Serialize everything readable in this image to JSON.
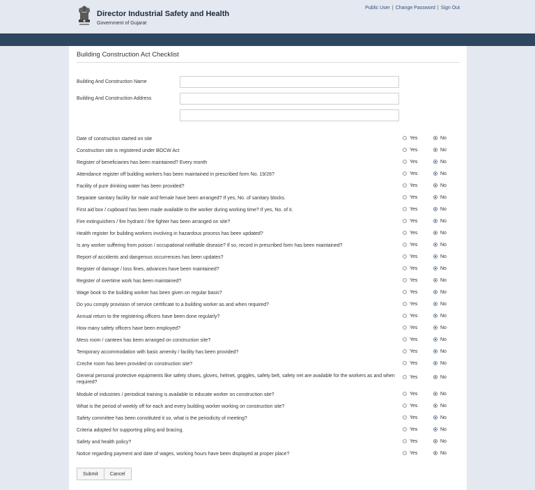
{
  "header": {
    "title": "Director Industrial Safety and Health",
    "subtitle": "Government of Gujarat",
    "links": {
      "public_user": "Public User",
      "sep1": "|",
      "change_password": "Change Password",
      "sep2": "|",
      "sign_out": "Sign Out"
    }
  },
  "form": {
    "heading": "Building Construction Act Checklist",
    "name_label": "Building And Construction Name",
    "address_label": "Building And Construction Address",
    "name_value": "",
    "address_value": "",
    "address_line2_value": "",
    "yes_label": "Yes",
    "no_label": "No",
    "questions": [
      {
        "text": "Date of construction started on site",
        "answer": "No"
      },
      {
        "text": "Construction site is registered under BOCW Act",
        "answer": "No"
      },
      {
        "text": "Register of beneficiaries has been maintained? Every month",
        "answer": "No"
      },
      {
        "text": "Attendance register off building workers has been maintained in prescribed form No. 19/26?",
        "answer": "No"
      },
      {
        "text": "Facility of pure drinking water has been provided?",
        "answer": "No"
      },
      {
        "text": "Separate sanitary facility for male and female have been arranged? If yes, No. of sanitary blocks.",
        "answer": "No"
      },
      {
        "text": "First aid box / cupboard has been made available to the worker during working time? If yes, No. of it.",
        "answer": "No"
      },
      {
        "text": "Fire extinguishers / fire hydrant / fire fighter has been arranged on site?",
        "answer": "No"
      },
      {
        "text": "Health register for building workers involving in hazardous process has been updated?",
        "answer": "No"
      },
      {
        "text": "Is any worker suffering from poison / occupational notifiable disease? If so, record in prescribed form has been maintained?",
        "answer": "No"
      },
      {
        "text": "Report of accidents and dangerous occurrences has been updates?",
        "answer": "No"
      },
      {
        "text": "Register of damage / loss fines, advances have been maintained?",
        "answer": "No"
      },
      {
        "text": "Register of overtime work has been maintained?",
        "answer": "No"
      },
      {
        "text": "Wage book to the building worker has been given on regular basis?",
        "answer": "No"
      },
      {
        "text": "Do you comply provision of service certificate to a building worker as and when required?",
        "answer": "No"
      },
      {
        "text": "Annual return to the registering officers have been done regularly?",
        "answer": "No"
      },
      {
        "text": "How many safety officers have been employed?",
        "answer": "No"
      },
      {
        "text": "Mess room / canteen has been arranged on construction site?",
        "answer": "No"
      },
      {
        "text": "Temporary accommodation with basic amenity / facility has been provided?",
        "answer": "No"
      },
      {
        "text": "Creche room has been provided on construction site?",
        "answer": "No"
      },
      {
        "text": "General personal protective equipments like safety shoes, gloves, helmet, goggles, safety belt, safety net are available for the workers as and when required?",
        "answer": "No"
      },
      {
        "text": "Module of industries / periodical training is available to educate worker on construction site?",
        "answer": "No"
      },
      {
        "text": "What is the period of weekly off for each and every building worker working on construction site?",
        "answer": "No"
      },
      {
        "text": "Safety committee has been constituted it so, what is the periodicity of meeting?",
        "answer": "No"
      },
      {
        "text": "Criteria adopted for supporting piling and bracing.",
        "answer": "No"
      },
      {
        "text": "Safety and health policy?",
        "answer": "No"
      },
      {
        "text": "Notice regarding payment and date of wages, working hours have been displayed at proper place?",
        "answer": "No"
      }
    ],
    "submit_label": "Submit",
    "cancel_label": "Cancel"
  },
  "icons": {
    "emblem": "national-emblem-icon"
  },
  "colors": {
    "navbar": "#2f4661",
    "background": "#e4e8f0",
    "link": "#33507a"
  }
}
